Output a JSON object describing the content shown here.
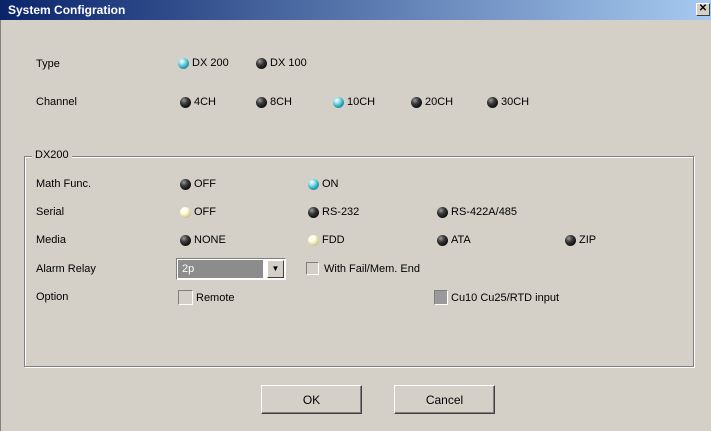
{
  "window": {
    "title": "System Configration",
    "close_glyph": "✕"
  },
  "type": {
    "label": "Type",
    "options": [
      {
        "label": "DX 200",
        "state": "on"
      },
      {
        "label": "DX 100",
        "state": "off"
      }
    ]
  },
  "channel": {
    "label": "Channel",
    "options": [
      {
        "label": "4CH",
        "state": "off"
      },
      {
        "label": "8CH",
        "state": "off"
      },
      {
        "label": "10CH",
        "state": "on"
      },
      {
        "label": "20CH",
        "state": "off"
      },
      {
        "label": "30CH",
        "state": "off"
      }
    ]
  },
  "dx200": {
    "group_label": "DX200",
    "math": {
      "label": "Math Func.",
      "options": [
        {
          "label": "OFF",
          "state": "off"
        },
        {
          "label": "ON",
          "state": "on"
        }
      ]
    },
    "serial": {
      "label": "Serial",
      "options": [
        {
          "label": "OFF",
          "state": "selected"
        },
        {
          "label": "RS-232",
          "state": "off"
        },
        {
          "label": "RS-422A/485",
          "state": "off"
        }
      ]
    },
    "media": {
      "label": "Media",
      "options": [
        {
          "label": "NONE",
          "state": "off"
        },
        {
          "label": "FDD",
          "state": "selected"
        },
        {
          "label": "ATA",
          "state": "off"
        },
        {
          "label": "ZIP",
          "state": "off"
        }
      ]
    },
    "alarm_relay": {
      "label": "Alarm Relay",
      "value": "2p",
      "arrow_glyph": "▼"
    },
    "with_fail": {
      "label": "With Fail/Mem. End",
      "checked": false
    },
    "option": {
      "label": "Option"
    },
    "remote": {
      "label": "Remote",
      "checked": false
    },
    "cu10": {
      "label": "Cu10 Cu25/RTD input",
      "checked": false
    }
  },
  "buttons": {
    "ok": "OK",
    "cancel": "Cancel"
  },
  "colors": {
    "title_start": "#0a246a",
    "title_end": "#a6caf0",
    "face": "#d4d0c8",
    "led_on": "#2ea3b8",
    "led_selected": "#e8e0b0",
    "led_off": "#222222"
  }
}
